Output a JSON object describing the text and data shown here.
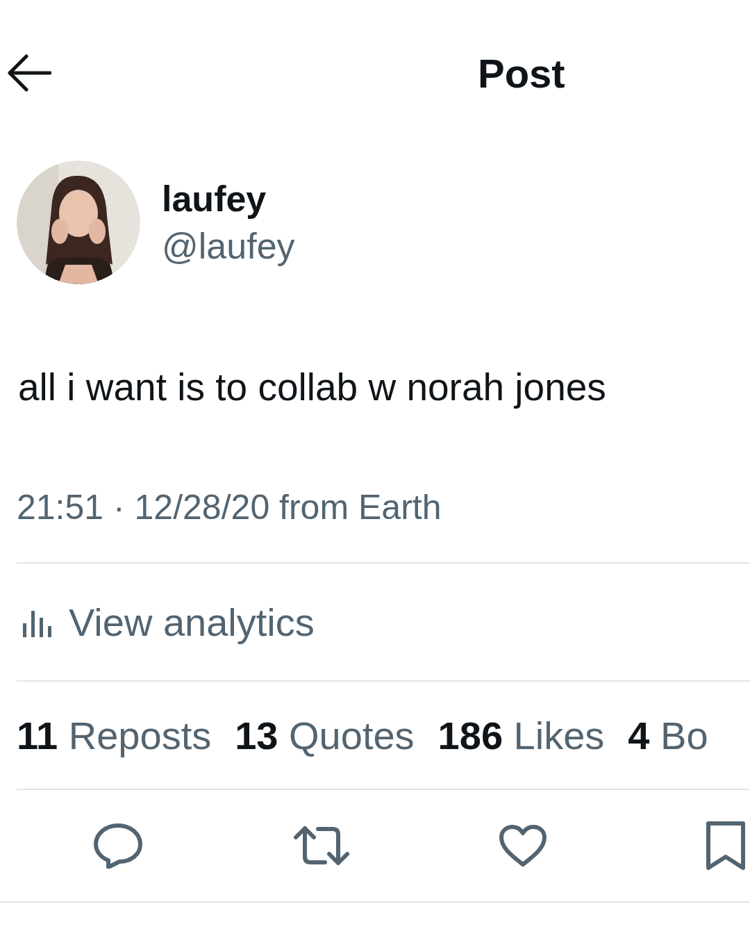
{
  "header": {
    "title": "Post"
  },
  "author": {
    "name": "laufey",
    "handle": "@laufey"
  },
  "post": {
    "text": "all i want is to collab w norah jones",
    "timestamp": "21:51 · 12/28/20 from Earth"
  },
  "analytics": {
    "label": "View analytics"
  },
  "stats": [
    {
      "count": "11",
      "label": "Reposts"
    },
    {
      "count": "13",
      "label": "Quotes"
    },
    {
      "count": "186",
      "label": "Likes"
    },
    {
      "count": "4",
      "label": "Bo"
    }
  ],
  "actions": [
    {
      "kind": "reply"
    },
    {
      "kind": "repost"
    },
    {
      "kind": "like"
    },
    {
      "kind": "bookmark"
    }
  ]
}
